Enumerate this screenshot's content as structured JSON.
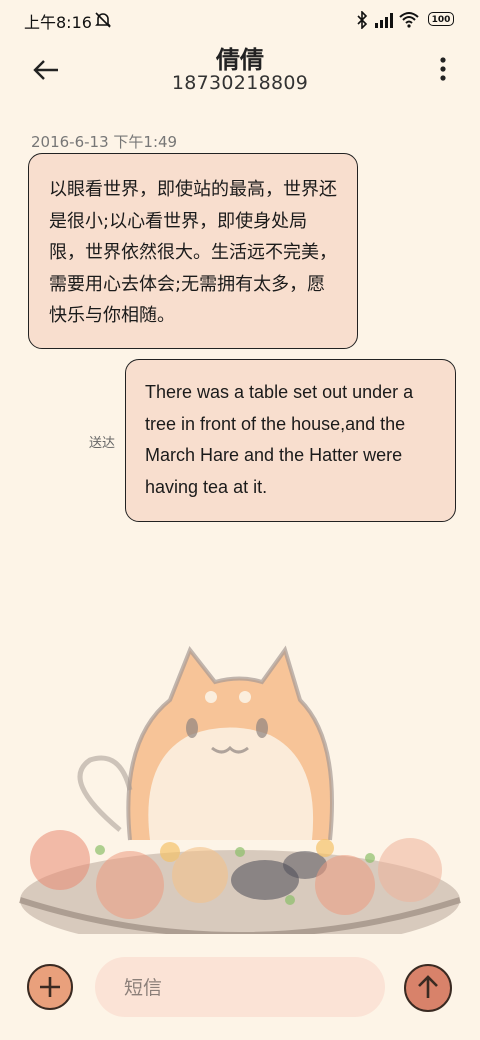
{
  "status_bar": {
    "time": "上午8:16",
    "battery": "100",
    "icons": [
      "mute-icon",
      "bluetooth-icon",
      "signal-icon",
      "wifi-icon",
      "battery-icon"
    ]
  },
  "header": {
    "contact_name": "倩倩",
    "phone_number": "18730218809",
    "back_icon": "back-arrow-icon",
    "menu_icon": "more-vert-icon"
  },
  "conversation": {
    "timestamp": "2016-6-13 下午1:49",
    "messages": [
      {
        "direction": "incoming",
        "text": "以眼看世界，即使站的最高，世界还是很小;以心看世界，即使身处局限，世界依然很大。生活远不完美，需要用心去体会;无需拥有太多，愿快乐与你相随。"
      },
      {
        "direction": "outgoing",
        "text": "There was a table set out under a tree in front of the house,and the March Hare and the Hatter were having tea at it.",
        "status": "送达"
      }
    ]
  },
  "composer": {
    "placeholder": "短信",
    "value": "",
    "add_icon": "plus-icon",
    "send_icon": "send-arrow-icon"
  },
  "colors": {
    "background": "#fdf4e7",
    "bubble": "#f8dece",
    "accent": "#e9a07c",
    "send": "#d8826a"
  }
}
